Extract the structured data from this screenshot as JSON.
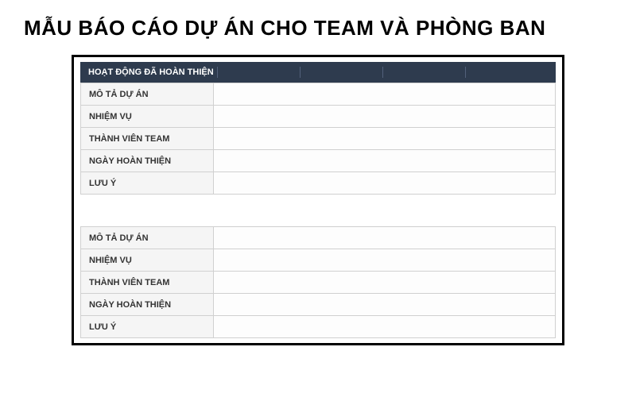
{
  "page_title": "MẪU BÁO CÁO DỰ ÁN CHO TEAM VÀ PHÒNG BAN",
  "header": {
    "title": "HOẠT ĐỘNG ĐÃ HOÀN THIỆN"
  },
  "table1": {
    "rows": [
      {
        "label": "MÔ TẢ DỰ ÁN",
        "value": ""
      },
      {
        "label": "NHIỆM VỤ",
        "value": ""
      },
      {
        "label": "THÀNH VIÊN TEAM",
        "value": ""
      },
      {
        "label": "NGÀY HOÀN THIỆN",
        "value": ""
      },
      {
        "label": "LƯU Ý",
        "value": ""
      }
    ]
  },
  "table2": {
    "rows": [
      {
        "label": "MÔ TẢ DỰ ÁN",
        "value": ""
      },
      {
        "label": "NHIỆM VỤ",
        "value": ""
      },
      {
        "label": "THÀNH VIÊN TEAM",
        "value": ""
      },
      {
        "label": "NGÀY HOÀN THIỆN",
        "value": ""
      },
      {
        "label": "LƯU Ý",
        "value": ""
      }
    ]
  }
}
